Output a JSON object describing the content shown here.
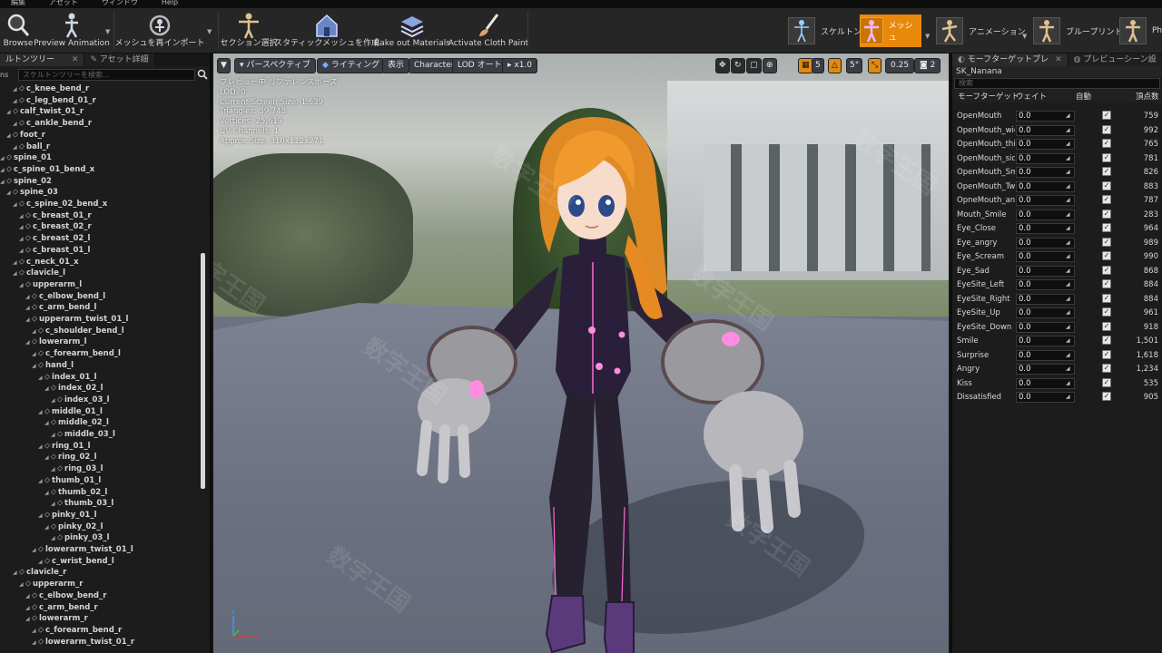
{
  "menubar": {
    "items": [
      "編集",
      "アセット",
      "ウィンドウ",
      "Help"
    ]
  },
  "toolbar": {
    "buttons": [
      "Browse",
      "Preview Animation",
      "メッシュを再インポート",
      "セクション選択",
      "スタティックメッシュを作成",
      "Bake out Materials",
      "Activate Cloth Paint"
    ],
    "modes": [
      "スケルトン",
      "メッシュ",
      "アニメーション",
      "ブループリント",
      "Ph"
    ]
  },
  "left": {
    "tabs": [
      "ルトンツリー",
      "アセット詳細"
    ],
    "search_prefix": "ns",
    "search_placeholder": "スケルトンツリーを検索...",
    "nodes": [
      {
        "label": "c_knee_bend_r",
        "indent": 14
      },
      {
        "label": "c_leg_bend_01_r",
        "indent": 14
      },
      {
        "label": "calf_twist_01_r",
        "indent": 7
      },
      {
        "label": "c_ankle_bend_r",
        "indent": 14
      },
      {
        "label": "foot_r",
        "indent": 7
      },
      {
        "label": "ball_r",
        "indent": 14
      },
      {
        "label": "spine_01",
        "indent": 0
      },
      {
        "label": "c_spine_01_bend_x",
        "indent": 0
      },
      {
        "label": "spine_02",
        "indent": 0
      },
      {
        "label": "spine_03",
        "indent": 7
      },
      {
        "label": "c_spine_02_bend_x",
        "indent": 14
      },
      {
        "label": "c_breast_01_r",
        "indent": 21
      },
      {
        "label": "c_breast_02_r",
        "indent": 21
      },
      {
        "label": "c_breast_02_l",
        "indent": 21
      },
      {
        "label": "c_breast_01_l",
        "indent": 21
      },
      {
        "label": "c_neck_01_x",
        "indent": 14
      },
      {
        "label": "clavicle_l",
        "indent": 14
      },
      {
        "label": "upperarm_l",
        "indent": 21
      },
      {
        "label": "c_elbow_bend_l",
        "indent": 28
      },
      {
        "label": "c_arm_bend_l",
        "indent": 28
      },
      {
        "label": "upperarm_twist_01_l",
        "indent": 28
      },
      {
        "label": "c_shoulder_bend_l",
        "indent": 35
      },
      {
        "label": "lowerarm_l",
        "indent": 28
      },
      {
        "label": "c_forearm_bend_l",
        "indent": 35
      },
      {
        "label": "hand_l",
        "indent": 35
      },
      {
        "label": "index_01_l",
        "indent": 42
      },
      {
        "label": "index_02_l",
        "indent": 49
      },
      {
        "label": "index_03_l",
        "indent": 56
      },
      {
        "label": "middle_01_l",
        "indent": 42
      },
      {
        "label": "middle_02_l",
        "indent": 49
      },
      {
        "label": "middle_03_l",
        "indent": 56
      },
      {
        "label": "ring_01_l",
        "indent": 42
      },
      {
        "label": "ring_02_l",
        "indent": 49
      },
      {
        "label": "ring_03_l",
        "indent": 56
      },
      {
        "label": "thumb_01_l",
        "indent": 42
      },
      {
        "label": "thumb_02_l",
        "indent": 49
      },
      {
        "label": "thumb_03_l",
        "indent": 56
      },
      {
        "label": "pinky_01_l",
        "indent": 42
      },
      {
        "label": "pinky_02_l",
        "indent": 49
      },
      {
        "label": "pinky_03_l",
        "indent": 56
      },
      {
        "label": "lowerarm_twist_01_l",
        "indent": 35
      },
      {
        "label": "c_wrist_bend_l",
        "indent": 42
      },
      {
        "label": "clavicle_r",
        "indent": 14
      },
      {
        "label": "upperarm_r",
        "indent": 21
      },
      {
        "label": "c_elbow_bend_r",
        "indent": 28
      },
      {
        "label": "c_arm_bend_r",
        "indent": 28
      },
      {
        "label": "lowerarm_r",
        "indent": 28
      },
      {
        "label": "c_forearm_bend_r",
        "indent": 35
      },
      {
        "label": "lowerarm_twist_01_r",
        "indent": 35
      }
    ]
  },
  "viewport": {
    "buttons": [
      "パースペクティブ",
      "ライティング",
      "表示",
      "Character",
      "LOD オート",
      "x1.0"
    ],
    "right_buttons": [
      "5",
      "5°",
      "0.25",
      "2"
    ],
    "stats": [
      "プレビュー中 リファレンスポーズ",
      "LOD: 0",
      "Current Screen Size: 1.639",
      "Triangles: 39,748",
      "Vertices: 25,619",
      "UV Channels: 1",
      "Approx Size: 310x112x271"
    ],
    "watermark": "数字王国"
  },
  "right": {
    "tabs": [
      "モーフターゲットプレ",
      "プレビューシーン設"
    ],
    "asset": "SK_Nanana",
    "search_placeholder": "検索",
    "headers": [
      "モーフターゲット",
      "ウェイト",
      "自動",
      "頂点数"
    ],
    "rows": [
      {
        "name": "OpenMouth",
        "weight": "0.0",
        "count": "759"
      },
      {
        "name": "OpenMouth_wide",
        "weight": "0.0",
        "count": "992"
      },
      {
        "name": "OpenMouth_thin",
        "weight": "0.0",
        "count": "765"
      },
      {
        "name": "OpenMouth_side",
        "weight": "0.0",
        "count": "781"
      },
      {
        "name": "OpenMouth_Smile",
        "weight": "0.0",
        "count": "826"
      },
      {
        "name": "OpenMouth_Twist",
        "weight": "0.0",
        "count": "883"
      },
      {
        "name": "OpneMouth_angry",
        "weight": "0.0",
        "count": "787"
      },
      {
        "name": "Mouth_Smile",
        "weight": "0.0",
        "count": "283"
      },
      {
        "name": "Eye_Close",
        "weight": "0.0",
        "count": "964"
      },
      {
        "name": "Eye_angry",
        "weight": "0.0",
        "count": "989"
      },
      {
        "name": "Eye_Scream",
        "weight": "0.0",
        "count": "990"
      },
      {
        "name": "Eye_Sad",
        "weight": "0.0",
        "count": "868"
      },
      {
        "name": "EyeSite_Left",
        "weight": "0.0",
        "count": "884"
      },
      {
        "name": "EyeSite_Right",
        "weight": "0.0",
        "count": "884"
      },
      {
        "name": "EyeSite_Up",
        "weight": "0.0",
        "count": "961"
      },
      {
        "name": "EyeSite_Down",
        "weight": "0.0",
        "count": "918"
      },
      {
        "name": "Smile",
        "weight": "0.0",
        "count": "1,501"
      },
      {
        "name": "Surprise",
        "weight": "0.0",
        "count": "1,618"
      },
      {
        "name": "Angry",
        "weight": "0.0",
        "count": "1,234"
      },
      {
        "name": "Kiss",
        "weight": "0.0",
        "count": "535"
      },
      {
        "name": "Dissatisfied",
        "weight": "0.0",
        "count": "905"
      }
    ]
  },
  "colors": {
    "accent": "#e8890c",
    "panel": "#1c1c1c",
    "suit": "#2a1f3a",
    "hair": "#e8902a"
  }
}
